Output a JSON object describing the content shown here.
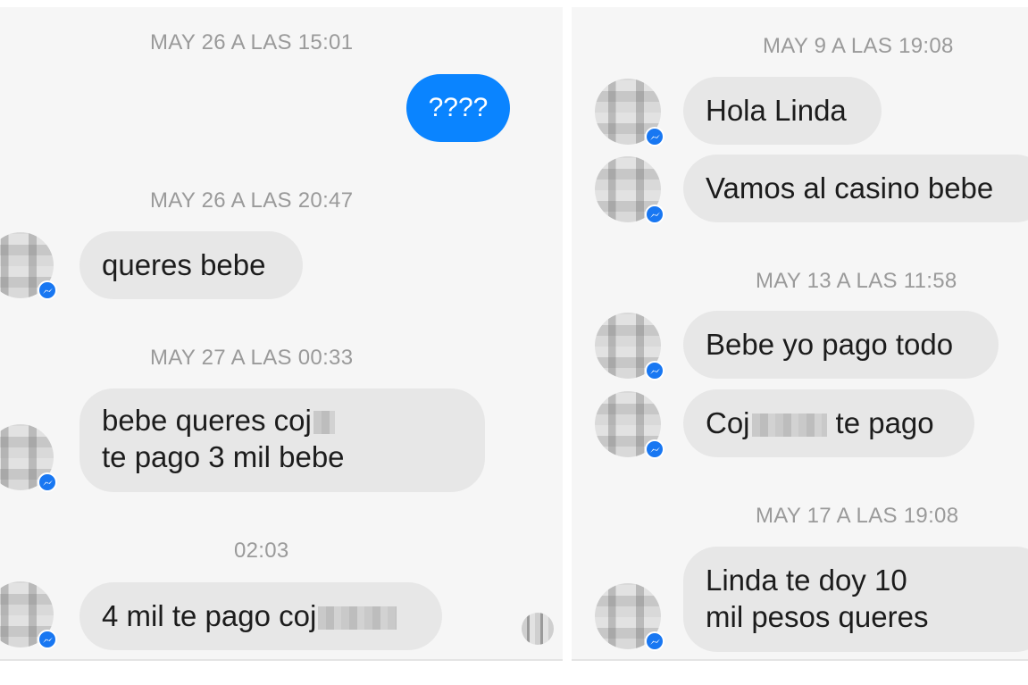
{
  "left": {
    "timestamps": [
      "MAY 26 A LAS 15:01",
      "MAY 26 A LAS 20:47",
      "MAY 27 A LAS 00:33",
      "02:03"
    ],
    "messages": [
      {
        "direction": "out",
        "text": "????"
      },
      {
        "direction": "in",
        "text": "queres bebe"
      },
      {
        "direction": "in",
        "line1": "bebe queres coj",
        "line2": "te pago 3 mil bebe"
      },
      {
        "direction": "in",
        "text": "4 mil te pago coj"
      }
    ]
  },
  "right": {
    "timestamps": [
      "MAY 9 A LAS 19:08",
      "MAY 13 A LAS 11:58",
      "MAY 17 A LAS 19:08"
    ],
    "messages": [
      {
        "direction": "in",
        "text": "Hola Linda"
      },
      {
        "direction": "in",
        "text": "Vamos al casino bebe"
      },
      {
        "direction": "in",
        "text": "Bebe yo pago todo"
      },
      {
        "direction": "in",
        "before": "Coj",
        "after": "te pago"
      },
      {
        "direction": "in",
        "line1": "Linda te doy 10",
        "line2": "mil pesos queres"
      }
    ]
  },
  "colors": {
    "outgoing_bubble": "#0a84ff",
    "incoming_bubble": "#e7e7e7",
    "background": "#f6f6f6",
    "timestamp": "#9a9a9a",
    "badge": "#1877f2"
  },
  "icons": [
    "messenger-badge-icon",
    "contact-avatar",
    "read-receipt-avatar"
  ]
}
